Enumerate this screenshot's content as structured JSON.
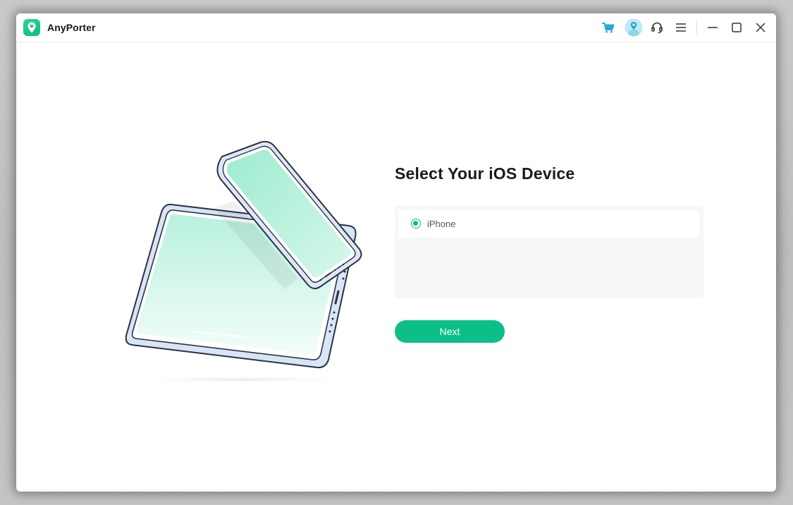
{
  "app": {
    "title": "AnyPorter",
    "logo_icon": "location-pin-icon",
    "brand_color": "#0cbf88"
  },
  "titlebar": {
    "icons": [
      "cart-icon",
      "avatar-icon",
      "headset-icon",
      "menu-icon",
      "minimize-icon",
      "maximize-icon",
      "close-icon"
    ],
    "cart_color": "#2aa8d6"
  },
  "main": {
    "heading": "Select Your iOS Device",
    "devices": [
      {
        "label": "iPhone",
        "selected": true
      }
    ],
    "next_label": "Next"
  }
}
